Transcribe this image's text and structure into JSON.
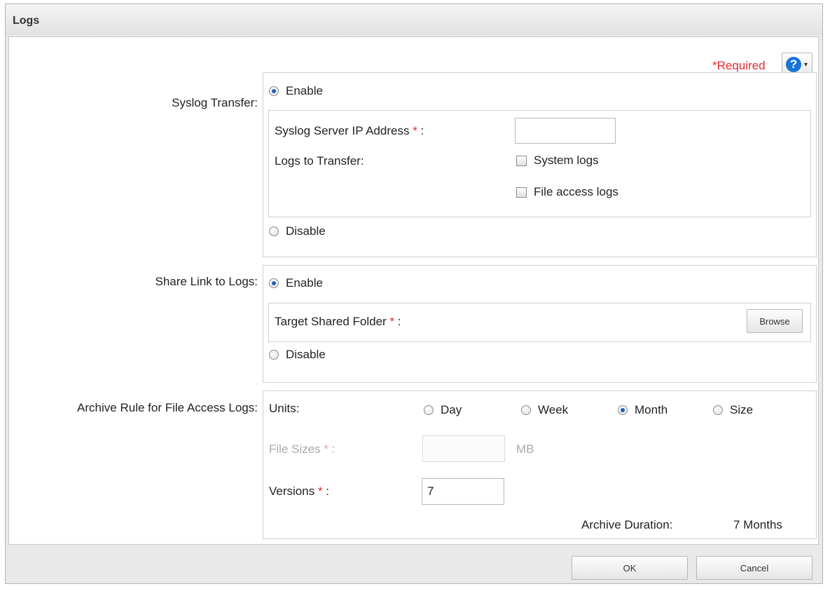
{
  "dialog": {
    "title": "Logs"
  },
  "required_label": "*Required",
  "help": {
    "icon": "?",
    "caret": "▾"
  },
  "syslog": {
    "label": "Syslog Transfer:",
    "enable_label": "Enable",
    "disable_label": "Disable",
    "selected": "enable",
    "server_ip_label": "Syslog Server IP Address",
    "server_ip_value": "",
    "logs_label": "Logs to Transfer:",
    "system_logs_label": "System logs",
    "system_logs_checked": false,
    "file_access_logs_label": "File access logs",
    "file_access_logs_checked": false
  },
  "share": {
    "label": "Share Link to Logs:",
    "enable_label": "Enable",
    "disable_label": "Disable",
    "selected": "enable",
    "target_label": "Target Shared Folder",
    "browse_label": "Browse"
  },
  "archive": {
    "label": "Archive Rule for File Access Logs:",
    "units_label": "Units:",
    "unit_options": [
      "Day",
      "Week",
      "Month",
      "Size"
    ],
    "selected_unit": "Month",
    "file_sizes_label": "File Sizes",
    "file_sizes_value": "",
    "file_sizes_unit": "MB",
    "versions_label": "Versions",
    "versions_value": "7",
    "duration_label": "Archive Duration:",
    "duration_value": "7 Months"
  },
  "required_marker": "*",
  "colon": ":",
  "footer": {
    "ok_label": "OK",
    "cancel_label": "Cancel"
  },
  "colors": {
    "required": "#e52b2b",
    "help_icon": "#1a73d9",
    "radio_selected": "#1e5fb8"
  }
}
